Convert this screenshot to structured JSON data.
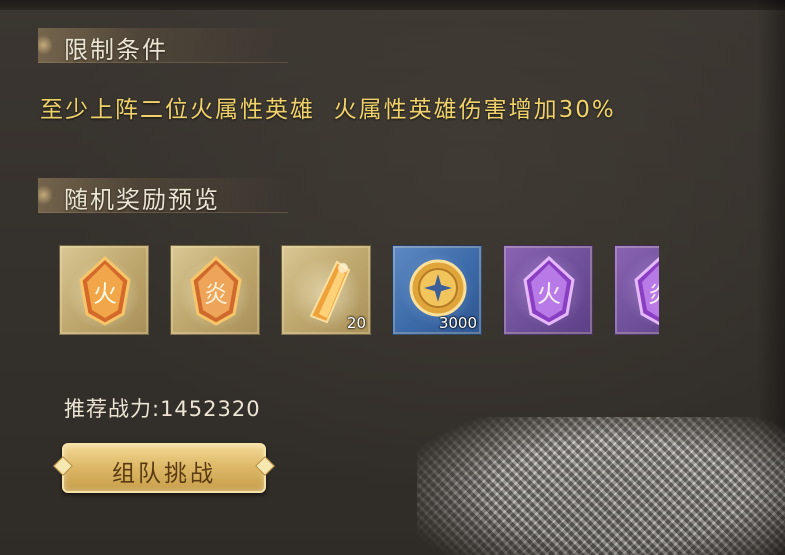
{
  "sections": {
    "restriction_title": "限制条件",
    "restriction_text": "至少上阵二位火属性英雄  火属性英雄伤害增加30%",
    "reward_title": "随机奖励预览"
  },
  "rewards": [
    {
      "icon": "fire-rune-gem-icon",
      "frame": "gold",
      "count": ""
    },
    {
      "icon": "fire-rune-gem-icon",
      "frame": "gold",
      "count": ""
    },
    {
      "icon": "crystal-shard-icon",
      "frame": "gold",
      "count": "20"
    },
    {
      "icon": "gold-coin-icon",
      "frame": "blue",
      "count": "3000"
    },
    {
      "icon": "purple-rune-gem-icon",
      "frame": "purple",
      "count": ""
    },
    {
      "icon": "purple-rune-gem-icon",
      "frame": "purple",
      "count": ""
    }
  ],
  "power": {
    "label": "推荐战力:1452320"
  },
  "button": {
    "label": "组队挑战"
  },
  "colors": {
    "accent_yellow": "#f0d26a",
    "button_gold": "#dcb765",
    "text_light": "#ece5d4"
  }
}
